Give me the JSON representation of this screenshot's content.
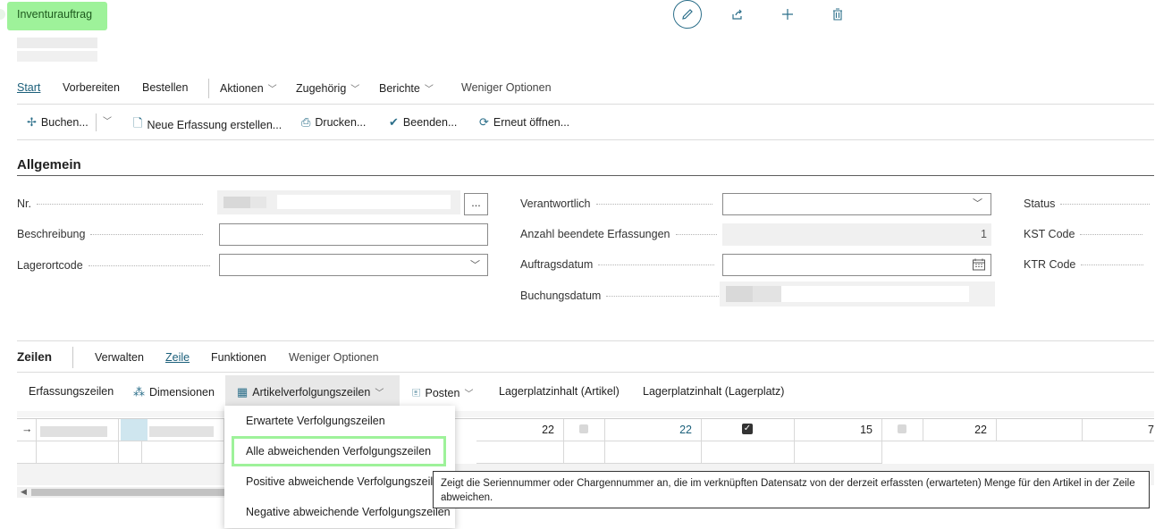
{
  "header": {
    "page_title": "Inventurauftrag",
    "icons": [
      "edit-icon",
      "share-icon",
      "add-icon",
      "delete-icon"
    ]
  },
  "menu": {
    "items": [
      {
        "label": "Start"
      },
      {
        "label": "Vorbereiten"
      },
      {
        "label": "Bestellen"
      },
      {
        "label": "Aktionen"
      },
      {
        "label": "Zugehörig"
      },
      {
        "label": "Berichte"
      },
      {
        "label": "Weniger Optionen"
      }
    ]
  },
  "actions": {
    "items": [
      {
        "label": "Buchen...",
        "icon": "post-icon"
      },
      {
        "label": "Neue Erfassung erstellen...",
        "icon": "new-document-icon"
      },
      {
        "label": "Drucken...",
        "icon": "print-icon"
      },
      {
        "label": "Beenden...",
        "icon": "checkmark-icon"
      },
      {
        "label": "Erneut öffnen...",
        "icon": "reopen-icon"
      }
    ]
  },
  "general": {
    "section_title": "Allgemein",
    "fields": {
      "nr": {
        "label": "Nr.",
        "assist": "..."
      },
      "beschreibung": {
        "label": "Beschreibung",
        "value": ""
      },
      "lagerortcode": {
        "label": "Lagerortcode",
        "value": ""
      },
      "verantwortlich": {
        "label": "Verantwortlich",
        "value": ""
      },
      "anzahl": {
        "label": "Anzahl beendete Erfassungen",
        "value": "1"
      },
      "auftragsdatum": {
        "label": "Auftragsdatum",
        "value": ""
      },
      "buchungsdatum": {
        "label": "Buchungsdatum"
      },
      "status": {
        "label": "Status"
      },
      "kst": {
        "label": "KST Code"
      },
      "ktr": {
        "label": "KTR Code"
      }
    }
  },
  "lines": {
    "section_title": "Zeilen",
    "tabs": [
      {
        "label": "Verwalten"
      },
      {
        "label": "Zeile"
      },
      {
        "label": "Funktionen"
      },
      {
        "label": "Weniger Optionen"
      }
    ],
    "toolbar": [
      {
        "label": "Erfassungszeilen"
      },
      {
        "label": "Dimensionen",
        "icon": "dimensions-icon"
      },
      {
        "label": "Artikelverfolgungszeilen",
        "icon": "grid-icon"
      },
      {
        "label": "Posten",
        "icon": "ledger-icon"
      },
      {
        "label": "Lagerplatzinhalt (Artikel)"
      },
      {
        "label": "Lagerplatzinhalt (Lagerplatz)"
      }
    ],
    "row": {
      "menge_basis": "22",
      "value_2": "22",
      "value_3": "15",
      "value_4": "22",
      "trailing": "7"
    }
  },
  "dropdown": {
    "items": [
      {
        "label": "Erwartete Verfolgungszeilen"
      },
      {
        "label": "Alle abweichenden Verfolgungszeilen"
      },
      {
        "label": "Positive abweichende Verfolgungszeilen"
      },
      {
        "label": "Negative abweichende Verfolgungszeilen"
      }
    ]
  },
  "tooltip": {
    "text": "Zeigt die Seriennummer oder Chargennummer an, die im verknüpften Datensatz von der derzeit erfassten (erwarteten) Menge für den Artikel in der Zeile abweichen."
  },
  "colors": {
    "accent": "#2c6f8a",
    "highlight": "#9ef29a"
  }
}
